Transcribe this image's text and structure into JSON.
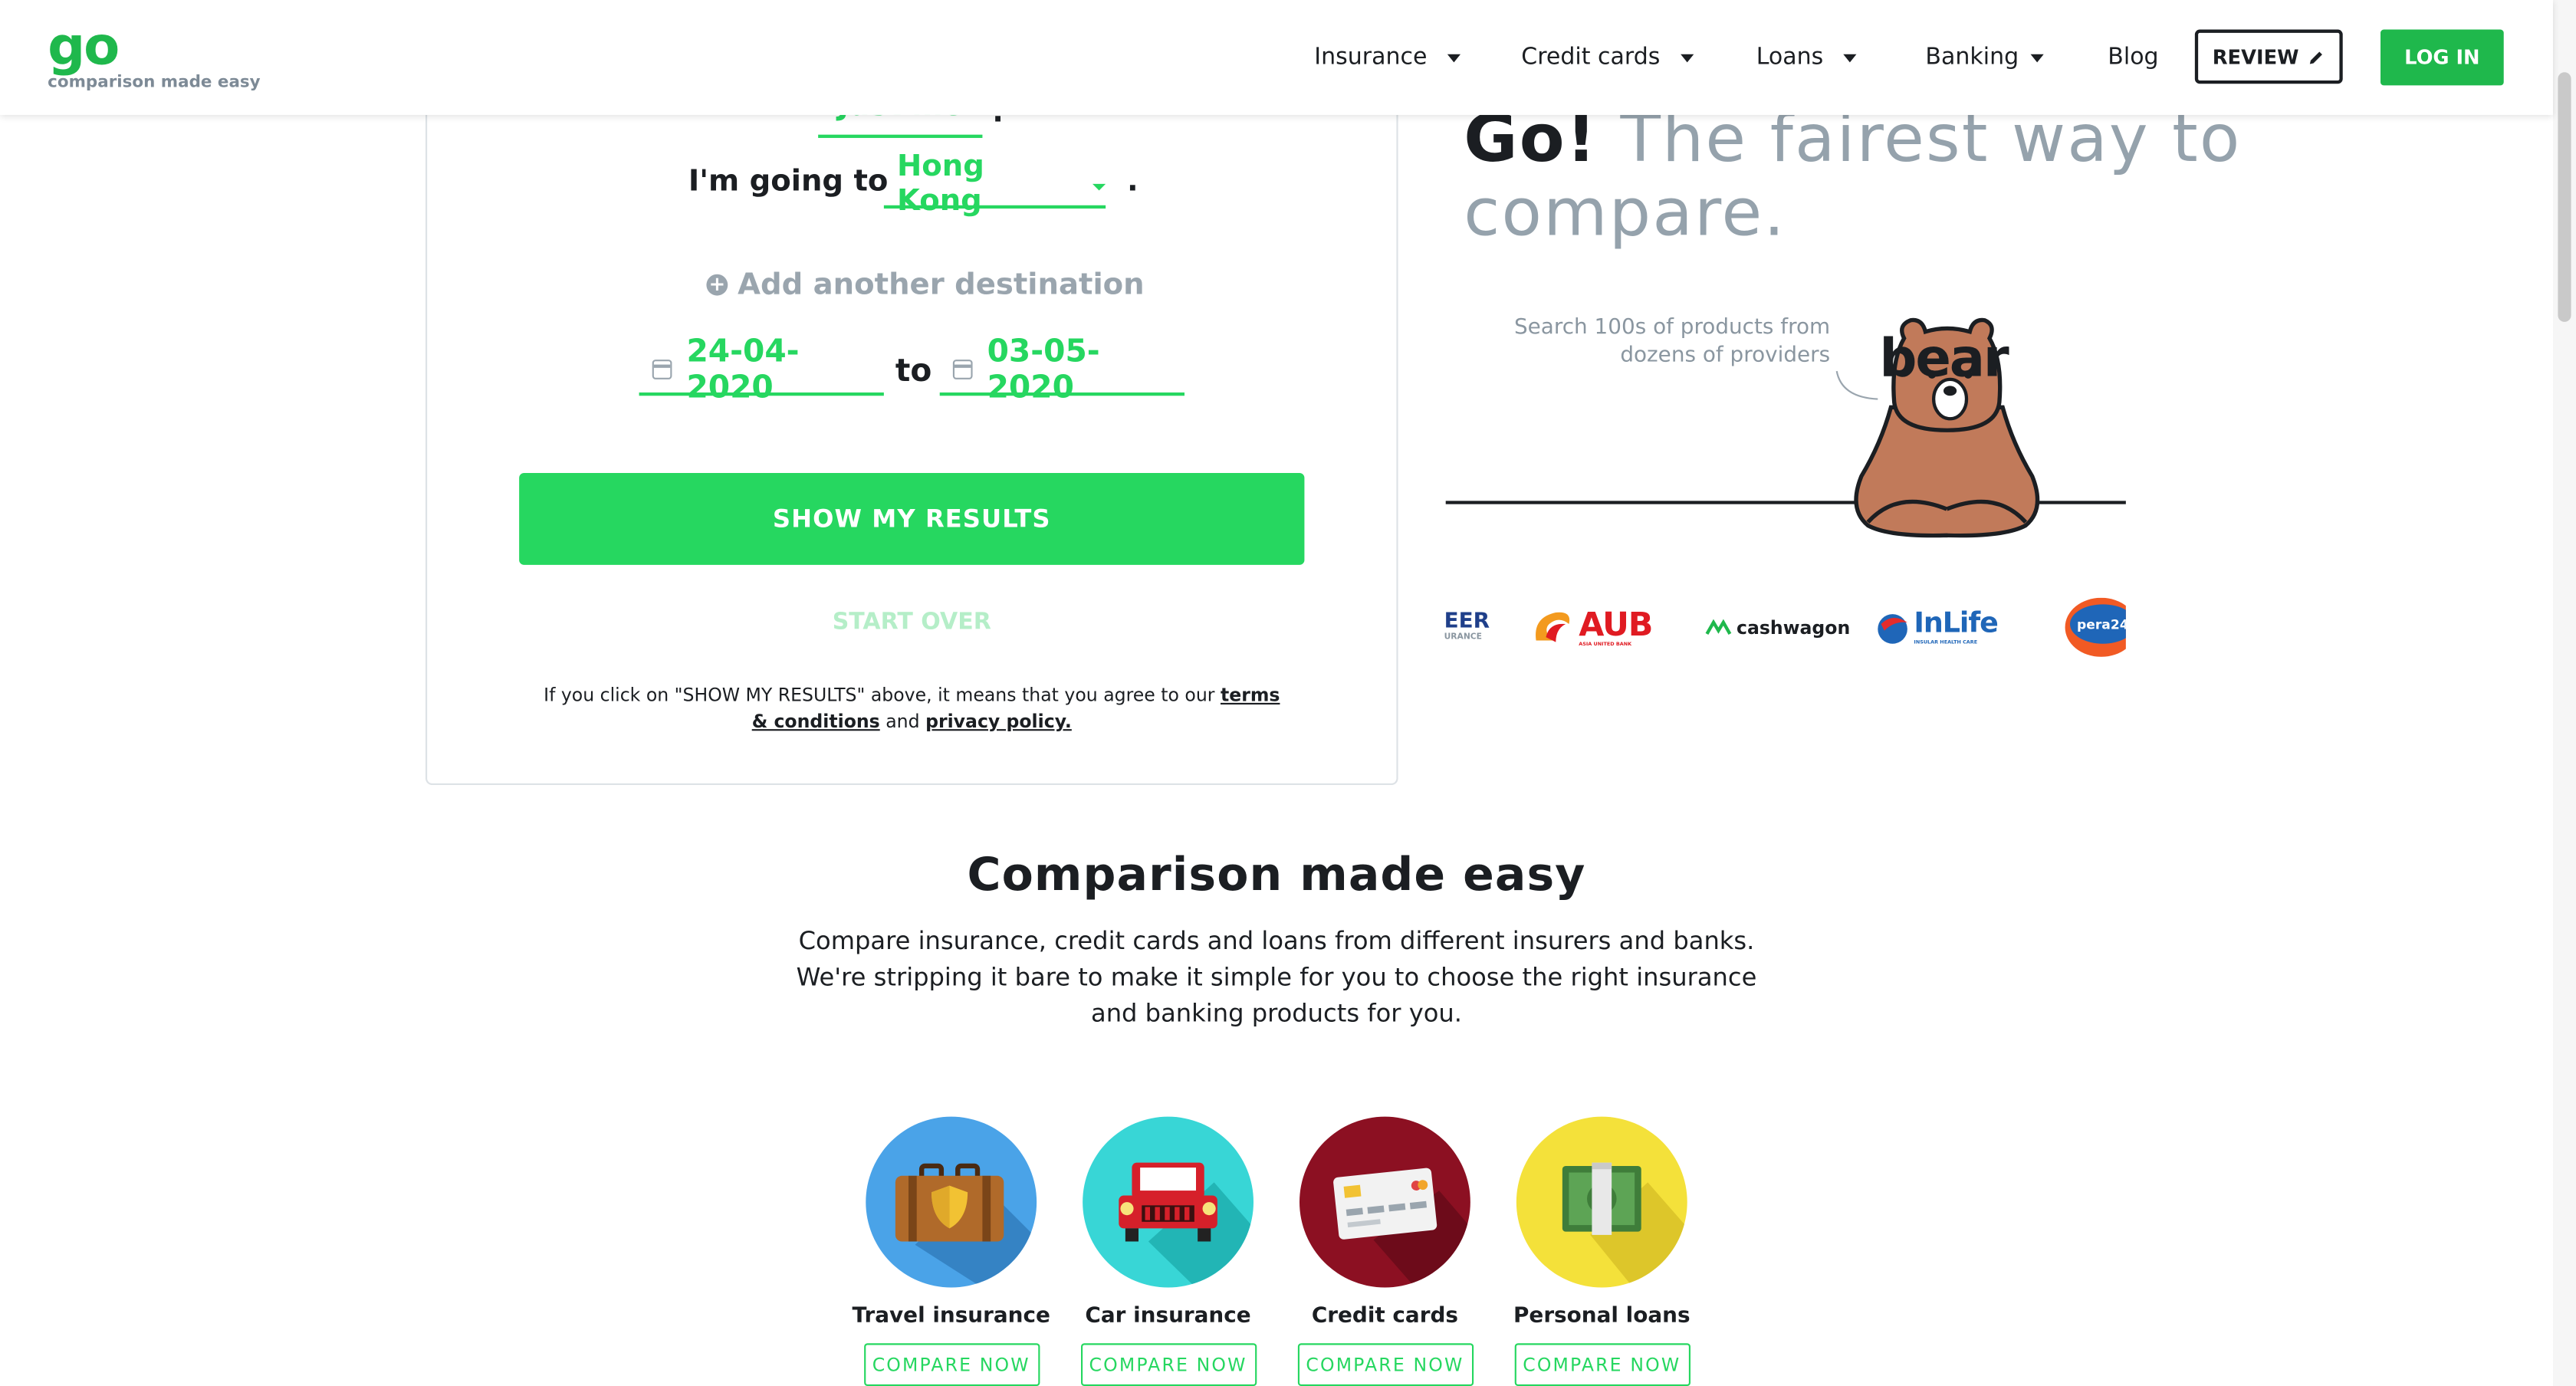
{
  "header": {
    "logo_go": "go",
    "logo_bear": "bear",
    "tagline": "comparison made easy",
    "nav": [
      {
        "label": "Insurance"
      },
      {
        "label": "Credit cards"
      },
      {
        "label": "Loans"
      },
      {
        "label": "Banking"
      },
      {
        "label": "Blog"
      }
    ],
    "review_label": "REVIEW",
    "login_label": "LOG IN"
  },
  "search": {
    "traveler_value": "Just me",
    "going_label": "I'm going to",
    "destination": "Hong Kong",
    "add_destination": "Add another destination",
    "date_from": "24-04-2020",
    "to_label": "to",
    "date_to": "03-05-2020",
    "show_results": "SHOW MY RESULTS",
    "start_over": "START OVER",
    "terms_prefix": "If you click on \"SHOW MY RESULTS\" above, it means that you agree to our",
    "terms_link": "terms & conditions",
    "terms_and": "and",
    "privacy_link": "privacy policy."
  },
  "promo": {
    "title_go": "Go!",
    "title_rest": "The fairest way to compare.",
    "subtitle": "Search 100s of products from dozens of providers",
    "partners": [
      "EER",
      "AUB",
      "cashwagon",
      "InLife",
      "pera24"
    ],
    "partner_small": {
      "eer": "URANCE",
      "aub": "ASIA UNITED BANK",
      "inlife": "INSULAR HEALTH CARE"
    }
  },
  "comparison": {
    "title": "Comparison made easy",
    "description": "Compare insurance, credit cards and loans from different insurers and banks. We're stripping it bare to make it simple for you to choose the right insurance and banking products for you.",
    "products": [
      {
        "label": "Travel insurance",
        "cta": "COMPARE NOW",
        "icon": "suitcase-shield-icon",
        "color": "#4aa3e8"
      },
      {
        "label": "Car insurance",
        "cta": "COMPARE NOW",
        "icon": "red-car-icon",
        "color": "#38d6d6"
      },
      {
        "label": "Credit cards",
        "cta": "COMPARE NOW",
        "icon": "credit-card-icon",
        "color": "#8c1022"
      },
      {
        "label": "Personal loans",
        "cta": "COMPARE NOW",
        "icon": "cash-stack-icon",
        "color": "#f4e13a"
      }
    ]
  }
}
